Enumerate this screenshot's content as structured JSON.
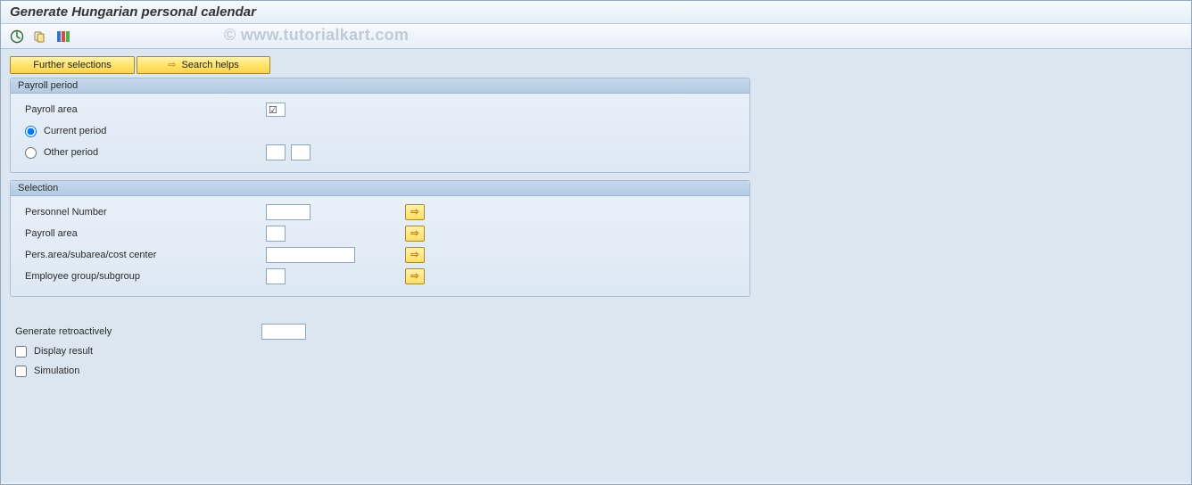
{
  "title": "Generate Hungarian personal calendar",
  "watermark": "© www.tutorialkart.com",
  "buttons": {
    "further_selections": "Further selections",
    "search_helps": "Search helps"
  },
  "groups": {
    "payroll_period": {
      "title": "Payroll period",
      "payroll_area_label": "Payroll area",
      "payroll_area_value": "",
      "current_period_label": "Current period",
      "current_period_selected": true,
      "other_period_label": "Other period",
      "other_period_selected": false,
      "other_from": "",
      "other_to": ""
    },
    "selection": {
      "title": "Selection",
      "rows": {
        "personnel_number": {
          "label": "Personnel Number",
          "value": ""
        },
        "payroll_area": {
          "label": "Payroll area",
          "value": ""
        },
        "pers_area": {
          "label": "Pers.area/subarea/cost center",
          "value": ""
        },
        "emp_group": {
          "label": "Employee group/subgroup",
          "value": ""
        }
      }
    }
  },
  "loose": {
    "generate_retro_label": "Generate retroactively",
    "generate_retro_value": "",
    "display_result_label": "Display result",
    "display_result_checked": false,
    "simulation_label": "Simulation",
    "simulation_checked": false
  }
}
